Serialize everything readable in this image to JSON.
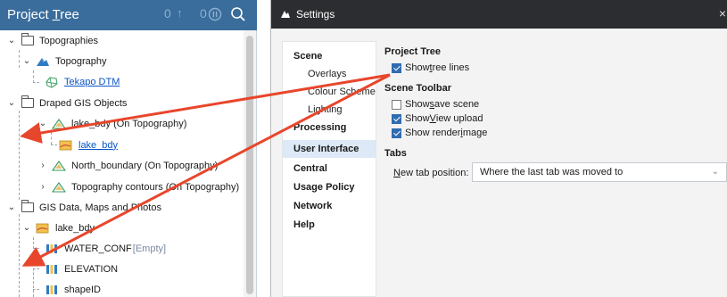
{
  "tree": {
    "title_prefix": "Project ",
    "title_underlined": "T",
    "title_suffix": "ree",
    "header_count_1": "0",
    "header_count_2": "0",
    "rows": [
      {
        "label": "Topographies"
      },
      {
        "label": "Topography"
      },
      {
        "label": "Tekapo DTM"
      },
      {
        "label": "Draped GIS Objects"
      },
      {
        "label": "lake_bdy (On Topography)"
      },
      {
        "label": "lake_bdy"
      },
      {
        "label": "North_boundary (On Topography)"
      },
      {
        "label": "Topography contours (On Topography)"
      },
      {
        "label": "GIS Data, Maps and Photos"
      },
      {
        "label": "lake_bdy"
      },
      {
        "label": "WATER_CONF",
        "tag": "[Empty]"
      },
      {
        "label": "ELEVATION"
      },
      {
        "label": "shapeID"
      }
    ]
  },
  "settings": {
    "title": "Settings",
    "close_glyph": "×",
    "nav": [
      {
        "label": "Scene"
      },
      {
        "label": "Overlays"
      },
      {
        "label": "Colour Scheme"
      },
      {
        "label": "Lighting"
      },
      {
        "label": "Processing"
      },
      {
        "label": "User Interface"
      },
      {
        "label": "Central"
      },
      {
        "label": "Usage Policy"
      },
      {
        "label": "Network"
      },
      {
        "label": "Help"
      }
    ],
    "project_tree": {
      "heading": "Project Tree",
      "show_tree_lines": {
        "pre": "Show ",
        "u": "t",
        "post": "ree lines",
        "checked": true
      }
    },
    "scene_toolbar": {
      "heading": "Scene Toolbar",
      "show_save_scene": {
        "pre": "Show ",
        "u": "s",
        "post": "ave scene",
        "checked": false
      },
      "show_view_upload": {
        "pre": "Show ",
        "u": "V",
        "post": "iew upload",
        "checked": true
      },
      "show_render_image": {
        "pre": "Show render ",
        "u": "i",
        "post": "mage",
        "checked": true
      }
    },
    "tabs": {
      "heading": "Tabs",
      "new_tab_label_u": "N",
      "new_tab_label_rest": "ew tab position:",
      "new_tab_value": "Where the last tab was moved to"
    }
  },
  "colors": {
    "tree_header": "#3a6d9c",
    "titlebar": "#2b2d30",
    "arrow": "#e8462c",
    "link": "#0b55c6",
    "checkbox": "#2f6db0"
  }
}
